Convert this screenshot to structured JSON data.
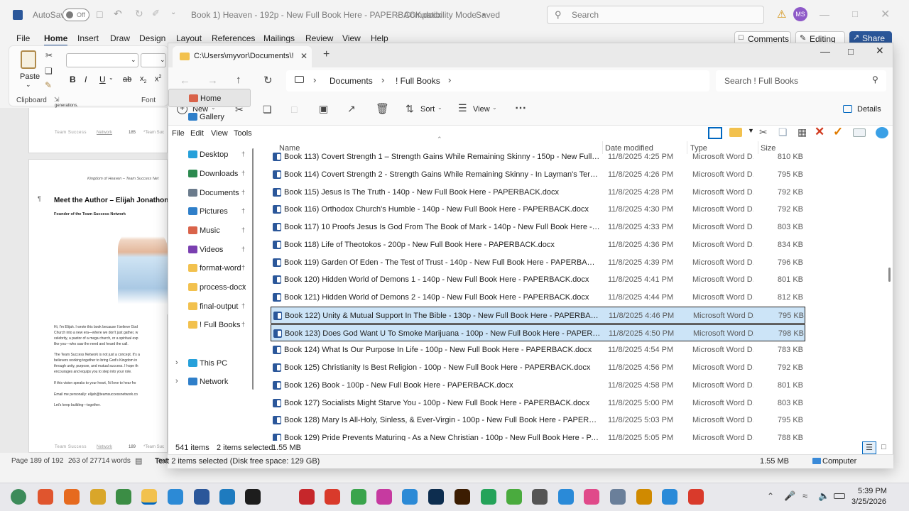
{
  "word": {
    "autosave_label": "AutoSave",
    "autosave_state": "Off",
    "doc_title": "Book 1) Heaven - 192p - New Full Book Here - PAPERBACK.docx",
    "compat": "Compatibility Mode",
    "saved": "Saved",
    "search_placeholder": "Search",
    "user_initials": "MS",
    "tabs": [
      "File",
      "Home",
      "Insert",
      "Draw",
      "Design",
      "Layout",
      "References",
      "Mailings",
      "Review",
      "View",
      "Help"
    ],
    "comments_label": "Comments",
    "editing_label": "Editing",
    "share_label": "Share",
    "paste_label": "Paste",
    "clipboard_label": "Clipboard",
    "font_label": "Font",
    "page_top_text": "generations.",
    "footer1_left": "Team Success",
    "footer1_link": "Network",
    "footer1_num": "185",
    "footer1_right": "*Team Suc",
    "header2": "Kingdom of Heaven – Team Success Net",
    "heading": "Meet the Author – Elijah Jonathon",
    "subheading": "Founder of the Team Success Network",
    "body_lines": [
      "Hi, I'm Elijah. I wrote this book because I believe God",
      "Church into a new era—where we don't just gather, w",
      "celebrity, a pastor of a mega church, or a spiritual exp",
      "like you—who saw the need and heard the call.",
      "",
      "The Team Success Network is not just a concept. It's a",
      "believers working together to bring God's Kingdom in",
      "through unity, purpose, and mutual success. I hope th",
      "encourages and equips you to step into your role.",
      "",
      "If this vision speaks to your heart, I'd love to hear fro",
      "",
      "Email me personally: elijah@teamsuccessnetwork.co",
      "",
      "Let's keep building—together."
    ],
    "footer2_left": "Team Success",
    "footer2_link": "Network",
    "footer2_num": "189",
    "footer2_right": "*Team Suc",
    "status_page": "Page 189 of 192",
    "status_words": "263 of 27714 words",
    "status_text": "Text"
  },
  "explorer": {
    "tab_title": "C:\\Users\\myvor\\Documents\\!",
    "breadcrumb": [
      "Documents",
      "! Full Books"
    ],
    "search_placeholder": "Search ! Full Books",
    "cmd": {
      "new": "New",
      "sort": "Sort",
      "view": "View",
      "details": "Details"
    },
    "menu": [
      "File",
      "Edit",
      "View",
      "Tools"
    ],
    "nav": [
      {
        "label": "Home",
        "icon": "home-icon",
        "color": "#d9634a"
      },
      {
        "label": "Gallery",
        "icon": "gallery-icon",
        "color": "#2f7fc9"
      },
      {
        "label": "Desktop",
        "icon": "desktop-icon",
        "color": "#26a0da"
      },
      {
        "label": "Downloads",
        "icon": "download-icon",
        "color": "#2c8a4f"
      },
      {
        "label": "Documents",
        "icon": "documents-icon",
        "color": "#6b7b8c"
      },
      {
        "label": "Pictures",
        "icon": "pictures-icon",
        "color": "#2f7fc9"
      },
      {
        "label": "Music",
        "icon": "music-icon",
        "color": "#d9634a"
      },
      {
        "label": "Videos",
        "icon": "videos-icon",
        "color": "#7a3fb0"
      },
      {
        "label": "format-word",
        "icon": "folder-icon",
        "color": "#f2c14e"
      },
      {
        "label": "process-docx",
        "icon": "folder-icon",
        "color": "#f2c14e"
      },
      {
        "label": "final-output",
        "icon": "folder-icon",
        "color": "#f2c14e"
      },
      {
        "label": "! Full Books",
        "icon": "folder-icon",
        "color": "#f2c14e"
      },
      {
        "label": "This PC",
        "icon": "pc-icon",
        "color": "#26a0da"
      },
      {
        "label": "Network",
        "icon": "network-icon",
        "color": "#2f7fc9"
      }
    ],
    "columns": {
      "name": "Name",
      "date": "Date modified",
      "type": "Type",
      "size": "Size"
    },
    "files": [
      {
        "name": "Book 113) Covert Strength 1 – Strength Gains While Remaining Skinny - 150p - New Full Book Here...",
        "date": "11/8/2025 4:25 PM",
        "type": "Microsoft Word D...",
        "size": "810 KB",
        "selected": false
      },
      {
        "name": "Book 114) Covert Strength 2 - Strength Gains While Remaining Skinny - In Layman's Terms - 140p - ...",
        "date": "11/8/2025 4:26 PM",
        "type": "Microsoft Word D...",
        "size": "795 KB",
        "selected": false
      },
      {
        "name": "Book 115) Jesus Is The Truth - 140p - New Full Book Here - PAPERBACK.docx",
        "date": "11/8/2025 4:28 PM",
        "type": "Microsoft Word D...",
        "size": "792 KB",
        "selected": false
      },
      {
        "name": "Book 116) Orthodox Church's Humble - 140p - New Full Book Here - PAPERBACK.docx",
        "date": "11/8/2025 4:30 PM",
        "type": "Microsoft Word D...",
        "size": "792 KB",
        "selected": false
      },
      {
        "name": "Book 117) 10 Proofs Jesus Is God From The Book of Mark - 140p - New Full Book Here - PAPERBAC...",
        "date": "11/8/2025 4:33 PM",
        "type": "Microsoft Word D...",
        "size": "803 KB",
        "selected": false
      },
      {
        "name": "Book 118) Life of Theotokos - 200p - New Full Book Here - PAPERBACK.docx",
        "date": "11/8/2025 4:36 PM",
        "type": "Microsoft Word D...",
        "size": "834 KB",
        "selected": false
      },
      {
        "name": "Book 119) Garden Of Eden - The Test of Trust - 140p - New Full Book Here - PAPERBACK.docx",
        "date": "11/8/2025 4:39 PM",
        "type": "Microsoft Word D...",
        "size": "796 KB",
        "selected": false
      },
      {
        "name": "Book 120) Hidden World of Demons 1 - 140p - New Full Book Here - PAPERBACK.docx",
        "date": "11/8/2025 4:41 PM",
        "type": "Microsoft Word D...",
        "size": "801 KB",
        "selected": false
      },
      {
        "name": "Book 121) Hidden World of Demons 2 - 140p - New Full Book Here - PAPERBACK.docx",
        "date": "11/8/2025 4:44 PM",
        "type": "Microsoft Word D...",
        "size": "812 KB",
        "selected": false
      },
      {
        "name": "Book 122) Unity & Mutual Support In The Bible - 130p - New Full Book Here - PAPERBACK.docx",
        "date": "11/8/2025 4:46 PM",
        "type": "Microsoft Word D...",
        "size": "795 KB",
        "selected": true
      },
      {
        "name": "Book 123) Does God Want U To Smoke Marijuana - 100p - New Full Book Here - PAPERBACK.docx",
        "date": "11/8/2025 4:50 PM",
        "type": "Microsoft Word D...",
        "size": "798 KB",
        "selected": true
      },
      {
        "name": "Book 124) What Is Our Purpose In Life - 100p - New Full Book Here - PAPERBACK.docx",
        "date": "11/8/2025 4:54 PM",
        "type": "Microsoft Word D...",
        "size": "783 KB",
        "selected": false
      },
      {
        "name": "Book 125) Christianity Is Best Religion - 100p - New Full Book Here - PAPERBACK.docx",
        "date": "11/8/2025 4:56 PM",
        "type": "Microsoft Word D...",
        "size": "792 KB",
        "selected": false
      },
      {
        "name": "Book 126) Book - 100p - New Full Book Here - PAPERBACK.docx",
        "date": "11/8/2025 4:58 PM",
        "type": "Microsoft Word D...",
        "size": "801 KB",
        "selected": false
      },
      {
        "name": "Book 127) Socialists Might Starve You - 100p - New Full Book Here - PAPERBACK.docx",
        "date": "11/8/2025 5:00 PM",
        "type": "Microsoft Word D...",
        "size": "803 KB",
        "selected": false
      },
      {
        "name": "Book 128) Mary Is All-Holy, Sinless, & Ever-Virgin - 100p - New Full Book Here - PAPERBACK.docx",
        "date": "11/8/2025 5:03 PM",
        "type": "Microsoft Word D...",
        "size": "795 KB",
        "selected": false
      },
      {
        "name": "Book 129) Pride Prevents Maturing - As a New Christian - 100p - New Full Book Here - PAPERBACK...",
        "date": "11/8/2025 5:05 PM",
        "type": "Microsoft Word D...",
        "size": "788 KB",
        "selected": false
      }
    ],
    "status_items": "541 items",
    "status_selected": "2 items selected",
    "status_size": "1.55 MB",
    "colors": {
      "selection": "#cce4f7",
      "accent": "#0067c0",
      "word_blue": "#2b579a"
    }
  },
  "bottom_status": {
    "left": "Text 2 items selected (Disk free space: 129 GB)",
    "size": "1.55 MB",
    "computer": "Computer"
  },
  "taskbar": {
    "time": "5:39 PM",
    "date": "3/25/2026"
  }
}
